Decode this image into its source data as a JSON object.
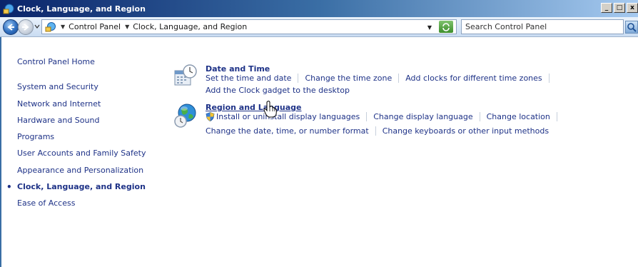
{
  "window": {
    "title": "Clock, Language, and Region",
    "controls": {
      "minimize": "_",
      "maximize": "□",
      "close": "x"
    }
  },
  "navbar": {
    "breadcrumbs": [
      "Control Panel",
      "Clock, Language, and Region"
    ],
    "search_placeholder": "Search Control Panel"
  },
  "sidebar": {
    "home": "Control Panel Home",
    "items": [
      {
        "label": "System and Security"
      },
      {
        "label": "Network and Internet"
      },
      {
        "label": "Hardware and Sound"
      },
      {
        "label": "Programs"
      },
      {
        "label": "User Accounts and Family Safety"
      },
      {
        "label": "Appearance and Personalization"
      },
      {
        "label": "Clock, Language, and Region",
        "current": true
      },
      {
        "label": "Ease of Access"
      }
    ],
    "bullet": "•"
  },
  "sections": {
    "date_time": {
      "title": "Date and Time",
      "tasks_row1": [
        "Set the time and date",
        "Change the time zone",
        "Add clocks for different time zones"
      ],
      "tasks_row2": [
        "Add the Clock gadget to the desktop"
      ]
    },
    "region_language": {
      "title": "Region and Language",
      "tasks_row1": [
        "Install or uninstall display languages",
        "Change display language",
        "Change location"
      ],
      "tasks_row2": [
        "Change the date, time, or number format",
        "Change keyboards or other input methods"
      ]
    }
  }
}
